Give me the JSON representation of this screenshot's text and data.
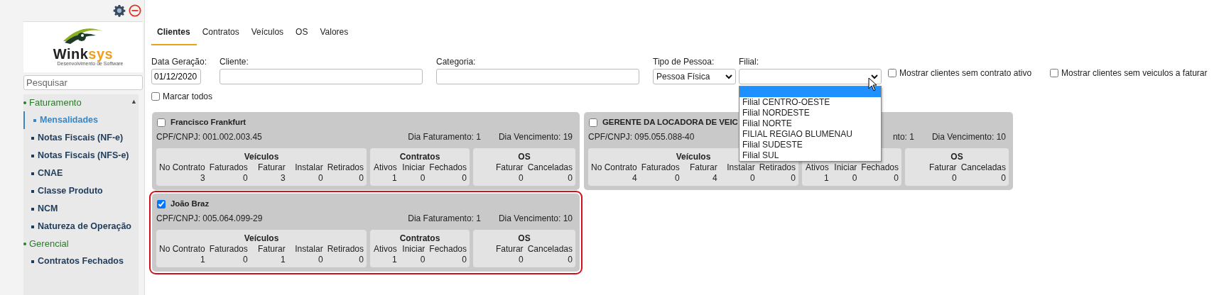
{
  "sidebar": {
    "logo": {
      "text_dark": "Wink",
      "text_accent": "sys",
      "tagline": "Desenvolvimento de Software"
    },
    "search": {
      "placeholder": "Pesquisar"
    },
    "scroll_arrow": "▲",
    "groups": [
      {
        "label": "Faturamento",
        "children": [
          {
            "label": "Mensalidades",
            "selected": true
          },
          {
            "label": "Notas Fiscais (NF-e)",
            "selected": false
          },
          {
            "label": "Notas Fiscais (NFS-e)",
            "selected": false
          },
          {
            "label": "CNAE",
            "selected": false
          },
          {
            "label": "Classe Produto",
            "selected": false
          },
          {
            "label": "NCM",
            "selected": false
          },
          {
            "label": "Natureza de Operação",
            "selected": false
          }
        ]
      },
      {
        "label": "Gerencial",
        "children": [
          {
            "label": "Contratos Fechados",
            "selected": false
          }
        ]
      }
    ]
  },
  "tabs": [
    {
      "label": "Clientes",
      "selected": true
    },
    {
      "label": "Contratos",
      "selected": false
    },
    {
      "label": "Veículos",
      "selected": false
    },
    {
      "label": "OS",
      "selected": false
    },
    {
      "label": "Valores",
      "selected": false
    }
  ],
  "filters": {
    "data_geracao": {
      "label": "Data Geração:",
      "value": "01/12/2020"
    },
    "cliente": {
      "label": "Cliente:"
    },
    "categoria": {
      "label": "Categoria:"
    },
    "tipo_pessoa": {
      "label": "Tipo de Pessoa:",
      "value": "Pessoa Física"
    },
    "filial": {
      "label": "Filial:",
      "expanded": true,
      "blank_option_highlighted": true,
      "options": [
        "Filial CENTRO-OESTE",
        "Filial NORDESTE",
        "Filial NORTE",
        "FILIAL REGIAO BLUMENAU",
        "Filial SUDESTE",
        "Filial SUL"
      ]
    },
    "checkboxes": [
      {
        "label": "Mostrar clientes sem contrato ativo",
        "checked": false
      },
      {
        "label": "Mostrar clientes sem veiculos a faturar",
        "checked": false
      }
    ],
    "marcar_todos": {
      "label": "Marcar todos",
      "checked": false
    }
  },
  "clients": [
    {
      "name": "Francisco Frankfurt",
      "checked": false,
      "cpf": "CPF/CNPJ: 001.002.003.45",
      "dia_faturamento": "Dia Faturamento: 1",
      "dia_vencimento": "Dia Vencimento: 19",
      "groups": [
        {
          "title": "Veículos",
          "columns": [
            {
              "label": "No Contrato",
              "value": "3"
            },
            {
              "label": "Faturados",
              "value": "0"
            },
            {
              "label": "Faturar",
              "value": "3"
            },
            {
              "label": "Instalar",
              "value": "0"
            },
            {
              "label": "Retirados",
              "value": "0"
            }
          ]
        },
        {
          "title": "Contratos",
          "columns": [
            {
              "label": "Ativos",
              "value": "1"
            },
            {
              "label": "Iniciar",
              "value": "0"
            },
            {
              "label": "Fechados",
              "value": "0"
            }
          ]
        },
        {
          "title": "OS",
          "columns": [
            {
              "label": "Faturar",
              "value": "0"
            },
            {
              "label": "Canceladas",
              "value": "0"
            }
          ]
        }
      ]
    },
    {
      "name": "GERENTE DA LOCADORA DE VEIC",
      "checked": false,
      "cpf": "CPF/CNPJ: 095.055.088-40",
      "dia_faturamento": "nto: 1",
      "dia_vencimento": "Dia Vencimento: 10",
      "groups": [
        {
          "title": "Veículos",
          "columns": [
            {
              "label": "No Contrato",
              "value": "4"
            },
            {
              "label": "Faturados",
              "value": "0"
            },
            {
              "label": "Faturar",
              "value": "4"
            },
            {
              "label": "Instalar",
              "value": "0"
            },
            {
              "label": "Retirados",
              "value": "0"
            }
          ]
        },
        {
          "columns": [
            {
              "label": "Ativos",
              "value": "1"
            },
            {
              "label": "Iniciar",
              "value": "0"
            },
            {
              "label": "Fechados",
              "value": "0"
            }
          ]
        },
        {
          "title": "OS",
          "columns": [
            {
              "label": "Faturar",
              "value": "0"
            },
            {
              "label": "Canceladas",
              "value": "0"
            }
          ]
        }
      ]
    },
    {
      "name": "João Braz",
      "checked": true,
      "cpf": "CPF/CNPJ: 005.064.099-29",
      "dia_faturamento": "Dia Faturamento: 1",
      "dia_vencimento": "Dia Vencimento: 10",
      "groups": [
        {
          "title": "Veículos",
          "columns": [
            {
              "label": "No Contrato",
              "value": "1"
            },
            {
              "label": "Faturados",
              "value": "0"
            },
            {
              "label": "Faturar",
              "value": "1"
            },
            {
              "label": "Instalar",
              "value": "0"
            },
            {
              "label": "Retirados",
              "value": "0"
            }
          ]
        },
        {
          "title": "Contratos",
          "columns": [
            {
              "label": "Ativos",
              "value": "1"
            },
            {
              "label": "Iniciar",
              "value": "0"
            },
            {
              "label": "Fechados",
              "value": "0"
            }
          ]
        },
        {
          "title": "OS",
          "columns": [
            {
              "label": "Faturar",
              "value": "0"
            },
            {
              "label": "Canceladas",
              "value": "0"
            }
          ]
        }
      ]
    }
  ]
}
